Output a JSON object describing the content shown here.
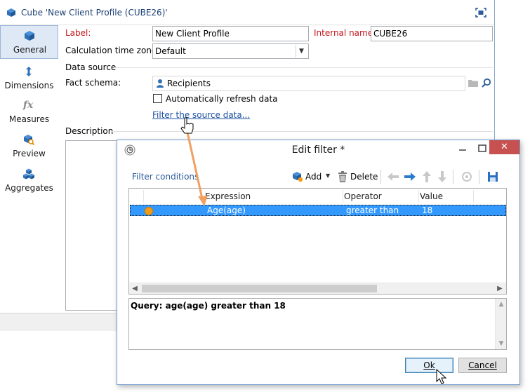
{
  "main_window": {
    "title": "Cube 'New Client Profile (CUBE26)'",
    "title_icon": "cube-icon",
    "maximize_icon": "maximize-icon"
  },
  "nav": {
    "items": [
      {
        "label": "General",
        "icon": "cube-icon",
        "active": true
      },
      {
        "label": "Dimensions",
        "icon": "dimensions-arrow-icon",
        "active": false
      },
      {
        "label": "Measures",
        "icon": "fx-icon",
        "active": false
      },
      {
        "label": "Preview",
        "icon": "preview-magnifier-icon",
        "active": false
      },
      {
        "label": "Aggregates",
        "icon": "aggregates-cubes-icon",
        "active": false
      }
    ]
  },
  "form": {
    "label_label": "Label:",
    "label_value": "New Client Profile",
    "internal_name_label": "Internal name:",
    "internal_name_value": "CUBE26",
    "timezone_label": "Calculation time zone:",
    "timezone_value": "Default",
    "data_source_section": "Data source",
    "fact_schema_label": "Fact schema:",
    "fact_schema_value": "Recipients",
    "auto_refresh_label": "Automatically refresh data",
    "auto_refresh_checked": false,
    "filter_link": "Filter the source data...",
    "description_section": "Description"
  },
  "dialog": {
    "title": "Edit filter *",
    "close_symbol": "✕",
    "toolbar": {
      "section_label": "Filter conditions",
      "add_label": "Add",
      "delete_label": "Delete"
    },
    "grid": {
      "columns": [
        "Expression",
        "Operator",
        "Value"
      ],
      "rows": [
        {
          "expression": "Age(age)",
          "operator": "greater than",
          "value": "18",
          "selected": true
        }
      ]
    },
    "query_text": "Query: age(age) greater than 18",
    "ok_label": "Ok",
    "cancel_label": "Cancel"
  },
  "colors": {
    "accent_blue": "#2a5b9b",
    "required_red": "#c4161c",
    "selection_blue": "#3399ff",
    "close_red": "#c75050",
    "arrow_orange": "#f0a060",
    "condition_dot": "#f39c12"
  }
}
